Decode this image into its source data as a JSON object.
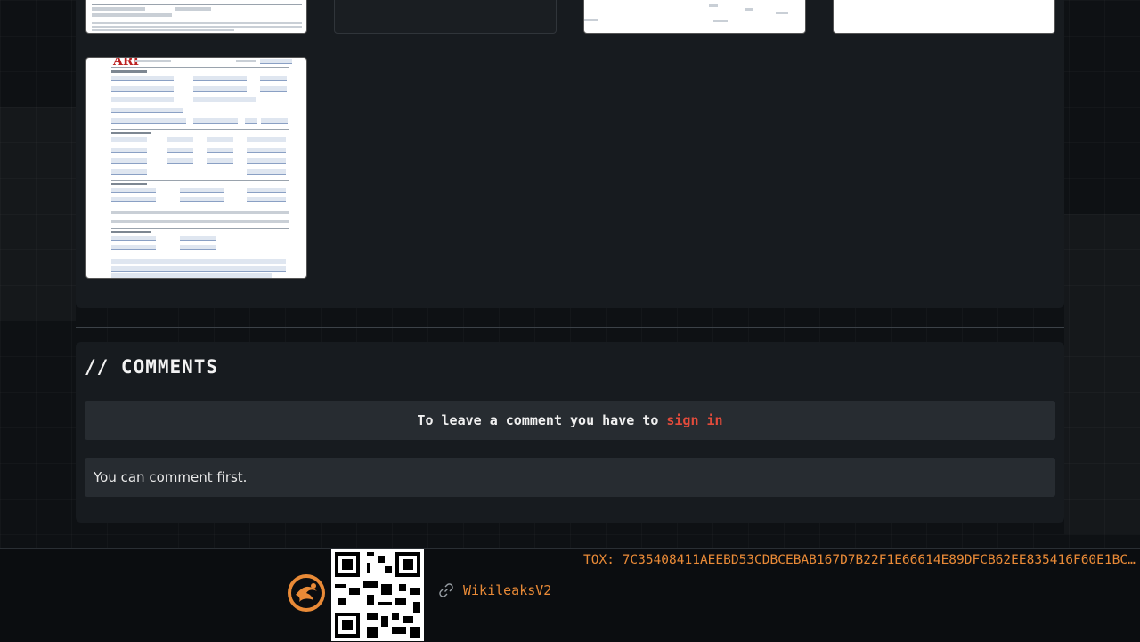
{
  "comments": {
    "title": "// COMMENTS",
    "signin_prefix": "To leave a comment you have to",
    "signin_link": "sign in",
    "empty_message": "You can comment first."
  },
  "footer": {
    "link_label": "WikileaksV2",
    "tox": "TOX: 7C35408411AEEBD53CDBCEBAB167D7B22F1E66614E89DFCB62EE835416F60E1BC..."
  },
  "colors": {
    "accent_orange": "#e98a37",
    "signin_red": "#e24b3b",
    "panel_bg": "#171b1f"
  },
  "icons": {
    "logo": "phoenix-logo-icon",
    "qr": "qr-code-icon",
    "link": "link-icon"
  }
}
